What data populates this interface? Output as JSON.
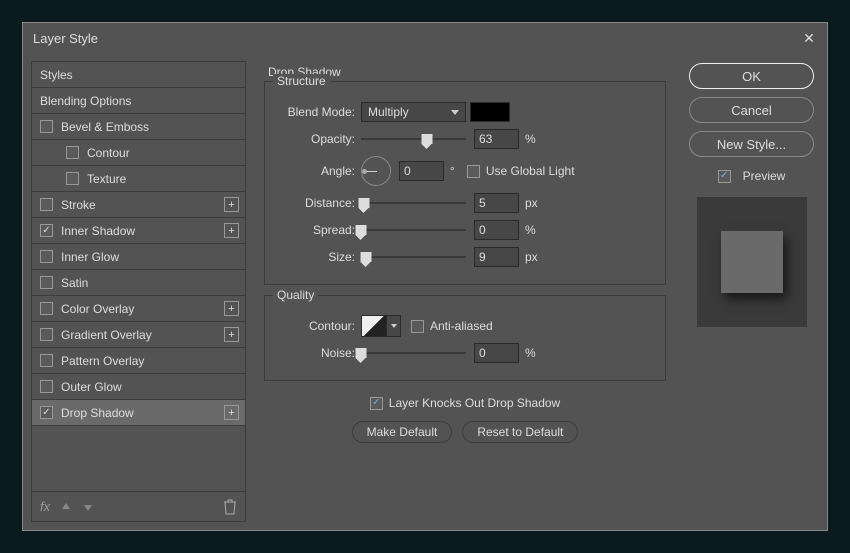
{
  "dialog": {
    "title": "Layer Style"
  },
  "sidebar": {
    "header": "Styles",
    "blending": "Blending Options",
    "items": [
      {
        "label": "Bevel & Emboss",
        "checked": false,
        "plus": false,
        "indent": false
      },
      {
        "label": "Contour",
        "checked": false,
        "plus": false,
        "indent": true
      },
      {
        "label": "Texture",
        "checked": false,
        "plus": false,
        "indent": true
      },
      {
        "label": "Stroke",
        "checked": false,
        "plus": true,
        "indent": false
      },
      {
        "label": "Inner Shadow",
        "checked": true,
        "plus": true,
        "indent": false
      },
      {
        "label": "Inner Glow",
        "checked": false,
        "plus": false,
        "indent": false
      },
      {
        "label": "Satin",
        "checked": false,
        "plus": false,
        "indent": false
      },
      {
        "label": "Color Overlay",
        "checked": false,
        "plus": true,
        "indent": false
      },
      {
        "label": "Gradient Overlay",
        "checked": false,
        "plus": true,
        "indent": false
      },
      {
        "label": "Pattern Overlay",
        "checked": false,
        "plus": false,
        "indent": false
      },
      {
        "label": "Outer Glow",
        "checked": false,
        "plus": false,
        "indent": false
      },
      {
        "label": "Drop Shadow",
        "checked": true,
        "plus": true,
        "indent": false,
        "active": true
      }
    ],
    "fx_label": "fx"
  },
  "main": {
    "title": "Drop Shadow",
    "structure": {
      "legend": "Structure",
      "blend_mode_label": "Blend Mode:",
      "blend_mode": "Multiply",
      "color": "#000000",
      "opacity_label": "Opacity:",
      "opacity": "63",
      "opacity_unit": "%",
      "angle_label": "Angle:",
      "angle": "0",
      "angle_unit": "°",
      "global_light_label": "Use Global Light",
      "global_light_checked": false,
      "distance_label": "Distance:",
      "distance": "5",
      "distance_unit": "px",
      "spread_label": "Spread:",
      "spread": "0",
      "spread_unit": "%",
      "size_label": "Size:",
      "size": "9",
      "size_unit": "px"
    },
    "quality": {
      "legend": "Quality",
      "contour_label": "Contour:",
      "aa_label": "Anti-aliased",
      "aa_checked": false,
      "noise_label": "Noise:",
      "noise": "0",
      "noise_unit": "%"
    },
    "knockout_label": "Layer Knocks Out Drop Shadow",
    "knockout_checked": true,
    "make_default": "Make Default",
    "reset_default": "Reset to Default"
  },
  "right": {
    "ok": "OK",
    "cancel": "Cancel",
    "new_style": "New Style...",
    "preview_label": "Preview",
    "preview_checked": true
  }
}
